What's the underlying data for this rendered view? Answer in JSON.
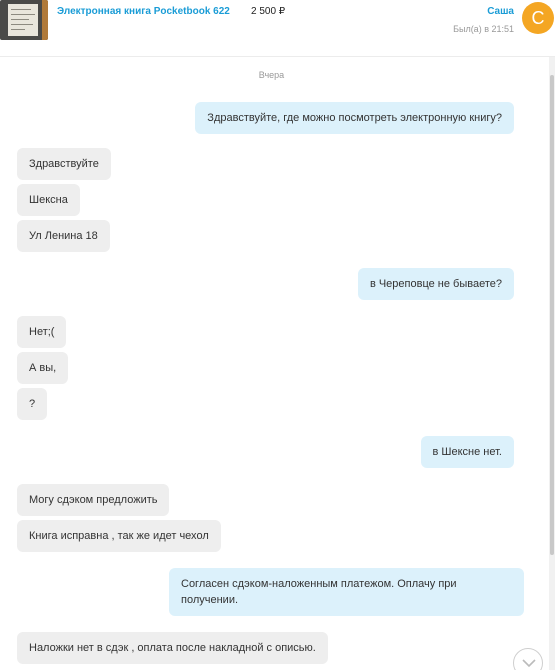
{
  "listing": {
    "title": "Электронная книга Pocketbook 622",
    "price": "2 500 ₽"
  },
  "contact": {
    "name": "Саша",
    "status": "Был(а) в 21:51",
    "avatar_letter": "С",
    "avatar_color": "#f4a623"
  },
  "chat": {
    "date_label": "Вчера",
    "messages": [
      {
        "dir": "out",
        "text": "Здравствуйте, где можно посмотреть электронную книгу?"
      },
      {
        "dir": "in",
        "text": "Здравствуйте"
      },
      {
        "dir": "in",
        "text": "Шексна"
      },
      {
        "dir": "in",
        "text": "Ул Ленина 18"
      },
      {
        "dir": "out",
        "text": "в Череповце не бываете?"
      },
      {
        "dir": "in",
        "text": "Нет;("
      },
      {
        "dir": "in",
        "text": "А вы,"
      },
      {
        "dir": "in",
        "text": "?"
      },
      {
        "dir": "out",
        "text": "в Шексне нет."
      },
      {
        "dir": "in",
        "text": "Могу сдэком предложить"
      },
      {
        "dir": "in",
        "text": "Книга исправна , так же идет чехол"
      },
      {
        "dir": "out",
        "text": "Согласен сдэком-наложенным платежом. Оплачу при получении."
      },
      {
        "dir": "in",
        "text": "Наложки нет в сдэк , оплата после накладной с описью."
      }
    ]
  },
  "icons": {
    "scroll_down": "chevron-down-icon"
  },
  "colors": {
    "link": "#1a9cd6",
    "incoming_bubble": "#eeeeee",
    "outgoing_bubble": "#dcf1fb"
  }
}
